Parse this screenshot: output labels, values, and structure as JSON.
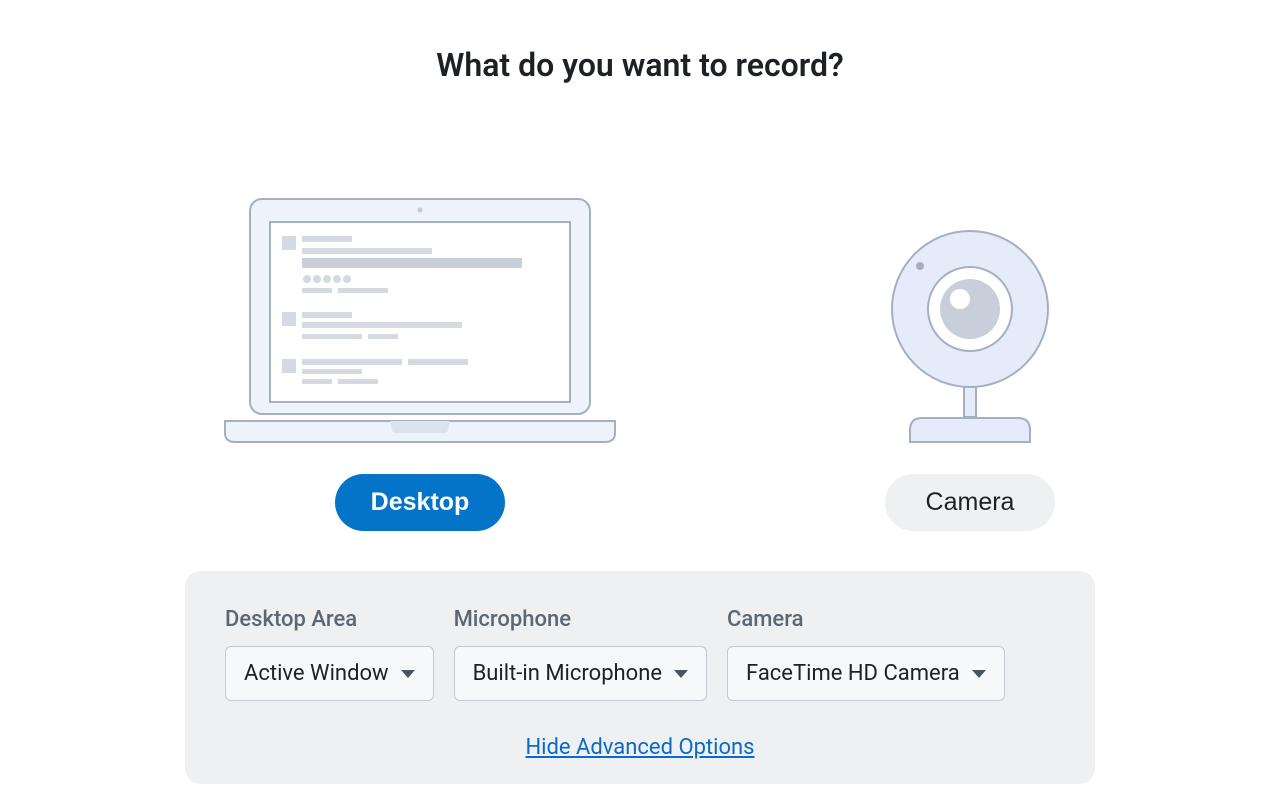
{
  "title": "What do you want to record?",
  "choices": {
    "desktop_label": "Desktop",
    "camera_label": "Camera"
  },
  "advanced": {
    "desktop_area": {
      "label": "Desktop Area",
      "value": "Active Window"
    },
    "microphone": {
      "label": "Microphone",
      "value": "Built-in Microphone"
    },
    "camera": {
      "label": "Camera",
      "value": "FaceTime HD Camera"
    },
    "toggle_label": "Hide Advanced Options"
  }
}
